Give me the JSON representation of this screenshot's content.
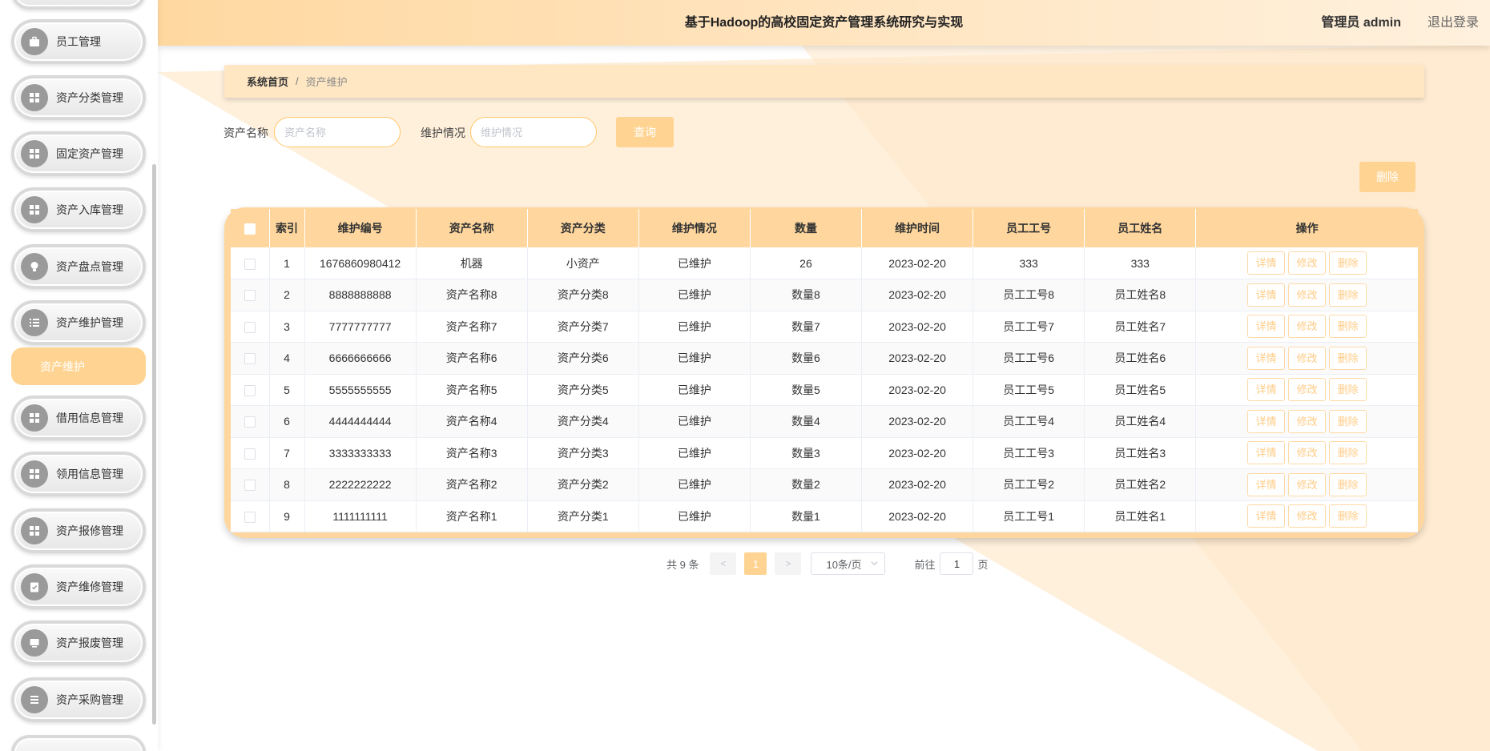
{
  "header": {
    "title": "基于Hadoop的高校固定资产管理系统研究与实现",
    "user": "管理员 admin",
    "logout": "退出登录"
  },
  "sidebar": {
    "items": [
      {
        "label": "员工管理",
        "icon": "briefcase-icon"
      },
      {
        "label": "资产分类管理",
        "icon": "grid-icon"
      },
      {
        "label": "固定资产管理",
        "icon": "grid-icon"
      },
      {
        "label": "资产入库管理",
        "icon": "grid-icon"
      },
      {
        "label": "资产盘点管理",
        "icon": "bulb-icon"
      },
      {
        "label": "资产维护管理",
        "icon": "list-icon"
      },
      {
        "label": "借用信息管理",
        "icon": "grid-icon"
      },
      {
        "label": "领用信息管理",
        "icon": "grid-icon"
      },
      {
        "label": "资产报修管理",
        "icon": "grid-icon"
      },
      {
        "label": "资产维修管理",
        "icon": "clipboard-icon"
      },
      {
        "label": "资产报废管理",
        "icon": "monitor-icon"
      },
      {
        "label": "资产采购管理",
        "icon": "menu-icon"
      }
    ],
    "active_sub": "资产维护"
  },
  "breadcrumb": {
    "home": "系统首页",
    "separator": "/",
    "current": "资产维护"
  },
  "search": {
    "asset_name_label": "资产名称",
    "asset_name_placeholder": "资产名称",
    "asset_name_value": "",
    "maint_label": "维护情况",
    "maint_placeholder": "维护情况",
    "maint_value": "",
    "query_button": "查询",
    "delete_button": "删除"
  },
  "table": {
    "columns": [
      "索引",
      "维护编号",
      "资产名称",
      "资产分类",
      "维护情况",
      "数量",
      "维护时间",
      "员工工号",
      "员工姓名",
      "操作"
    ],
    "actions": [
      "详情",
      "修改",
      "删除"
    ],
    "rows": [
      {
        "index": "1",
        "code": "1676860980412",
        "name": "机器",
        "category": "小资产",
        "status": "已维护",
        "qty": "26",
        "date": "2023-02-20",
        "emp_no": "333",
        "emp_name": "333"
      },
      {
        "index": "2",
        "code": "8888888888",
        "name": "资产名称8",
        "category": "资产分类8",
        "status": "已维护",
        "qty": "数量8",
        "date": "2023-02-20",
        "emp_no": "员工工号8",
        "emp_name": "员工姓名8"
      },
      {
        "index": "3",
        "code": "7777777777",
        "name": "资产名称7",
        "category": "资产分类7",
        "status": "已维护",
        "qty": "数量7",
        "date": "2023-02-20",
        "emp_no": "员工工号7",
        "emp_name": "员工姓名7"
      },
      {
        "index": "4",
        "code": "6666666666",
        "name": "资产名称6",
        "category": "资产分类6",
        "status": "已维护",
        "qty": "数量6",
        "date": "2023-02-20",
        "emp_no": "员工工号6",
        "emp_name": "员工姓名6"
      },
      {
        "index": "5",
        "code": "5555555555",
        "name": "资产名称5",
        "category": "资产分类5",
        "status": "已维护",
        "qty": "数量5",
        "date": "2023-02-20",
        "emp_no": "员工工号5",
        "emp_name": "员工姓名5"
      },
      {
        "index": "6",
        "code": "4444444444",
        "name": "资产名称4",
        "category": "资产分类4",
        "status": "已维护",
        "qty": "数量4",
        "date": "2023-02-20",
        "emp_no": "员工工号4",
        "emp_name": "员工姓名4"
      },
      {
        "index": "7",
        "code": "3333333333",
        "name": "资产名称3",
        "category": "资产分类3",
        "status": "已维护",
        "qty": "数量3",
        "date": "2023-02-20",
        "emp_no": "员工工号3",
        "emp_name": "员工姓名3"
      },
      {
        "index": "8",
        "code": "2222222222",
        "name": "资产名称2",
        "category": "资产分类2",
        "status": "已维护",
        "qty": "数量2",
        "date": "2023-02-20",
        "emp_no": "员工工号2",
        "emp_name": "员工姓名2"
      },
      {
        "index": "9",
        "code": "1111111111",
        "name": "资产名称1",
        "category": "资产分类1",
        "status": "已维护",
        "qty": "数量1",
        "date": "2023-02-20",
        "emp_no": "员工工号1",
        "emp_name": "员工姓名1"
      }
    ]
  },
  "pagination": {
    "total_text": "共 9 条",
    "prev": "<",
    "next": ">",
    "current_page": "1",
    "page_size": "10条/页",
    "jump_label": "前往",
    "jump_value": "1",
    "jump_unit": "页"
  },
  "colors": {
    "accent": "#ffd493",
    "header_start": "#ffd8a0",
    "table_frame": "#ffd79e",
    "action_text": "#ffcc86"
  }
}
